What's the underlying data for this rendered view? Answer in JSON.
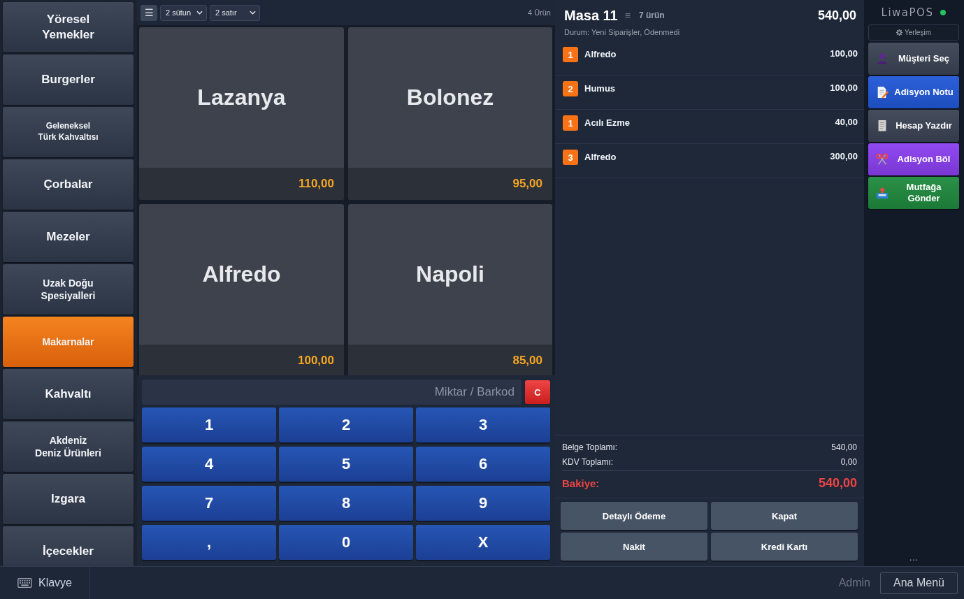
{
  "categories": [
    {
      "label": "Yöresel\nYemekler",
      "selected": false
    },
    {
      "label": "Burgerler",
      "selected": false
    },
    {
      "label": "Geleneksel\nTürk Kahvaltısı",
      "selected": false
    },
    {
      "label": "Çorbalar",
      "selected": false
    },
    {
      "label": "Mezeler",
      "selected": false
    },
    {
      "label": "Uzak Doğu\nSpesiyalleri",
      "selected": false
    },
    {
      "label": "Makarnalar",
      "selected": true
    },
    {
      "label": "Kahvaltı",
      "selected": false
    },
    {
      "label": "Akdeniz\nDeniz Ürünleri",
      "selected": false
    },
    {
      "label": "Izgara",
      "selected": false
    },
    {
      "label": "İçecekler",
      "selected": false
    }
  ],
  "toolbar": {
    "menu_icon": "☰",
    "column_select": "2 sütun",
    "row_select": "2 satır",
    "count": "4 Ürün"
  },
  "products": [
    {
      "name": "Lazanya",
      "price": "110,00"
    },
    {
      "name": "Bolonez",
      "price": "95,00"
    },
    {
      "name": "Alfredo",
      "price": "100,00"
    },
    {
      "name": "Napoli",
      "price": "85,00"
    }
  ],
  "keypad": {
    "placeholder": "Miktar / Barkod",
    "clear": "C",
    "keys": [
      "1",
      "2",
      "3",
      "4",
      "5",
      "6",
      "7",
      "8",
      "9",
      ",",
      "0",
      "X"
    ]
  },
  "order": {
    "title": "Masa 11",
    "list_icon": "≡",
    "item_count": "7 ürün",
    "total": "540,00",
    "status": "Durum: Yeni Siparişler, Ödenmedi",
    "items": [
      {
        "qty": "1",
        "name": "Alfredo",
        "price": "100,00"
      },
      {
        "qty": "2",
        "name": "Humus",
        "price": "100,00"
      },
      {
        "qty": "1",
        "name": "Acılı Ezme",
        "price": "40,00"
      },
      {
        "qty": "3",
        "name": "Alfredo",
        "price": "300,00"
      }
    ],
    "summary": [
      {
        "label": "Belge Toplamı:",
        "value": "540,00"
      },
      {
        "label": "KDV Toplamı:",
        "value": "0,00"
      }
    ],
    "balance": {
      "label": "Bakiye:",
      "value": "540,00"
    },
    "payment_buttons": [
      "Detaylı Ödeme",
      "Kapat",
      "Nakit",
      "Kredi Kartı"
    ]
  },
  "sidebar": {
    "logo": "LiwaPOS",
    "online": true,
    "layout_button": "Yerleşim",
    "actions": [
      {
        "kind": "customer",
        "label": "Müşteri Seç",
        "color": "#3b4455"
      },
      {
        "kind": "note",
        "label": "Adisyon Notu",
        "color": "#2158d8"
      },
      {
        "kind": "print",
        "label": "Hesap Yazdır",
        "color": "#3b4455"
      },
      {
        "kind": "split",
        "label": "Adisyon Böl",
        "color": "#8b3ff0"
      },
      {
        "kind": "kitchen",
        "label": "Mutfağa Gönder",
        "color": "#1f8a3e"
      }
    ],
    "more": "…"
  },
  "footer": {
    "keyboard_button": "Klavye",
    "user": "Admin",
    "main_menu_button": "Ana Menü"
  }
}
